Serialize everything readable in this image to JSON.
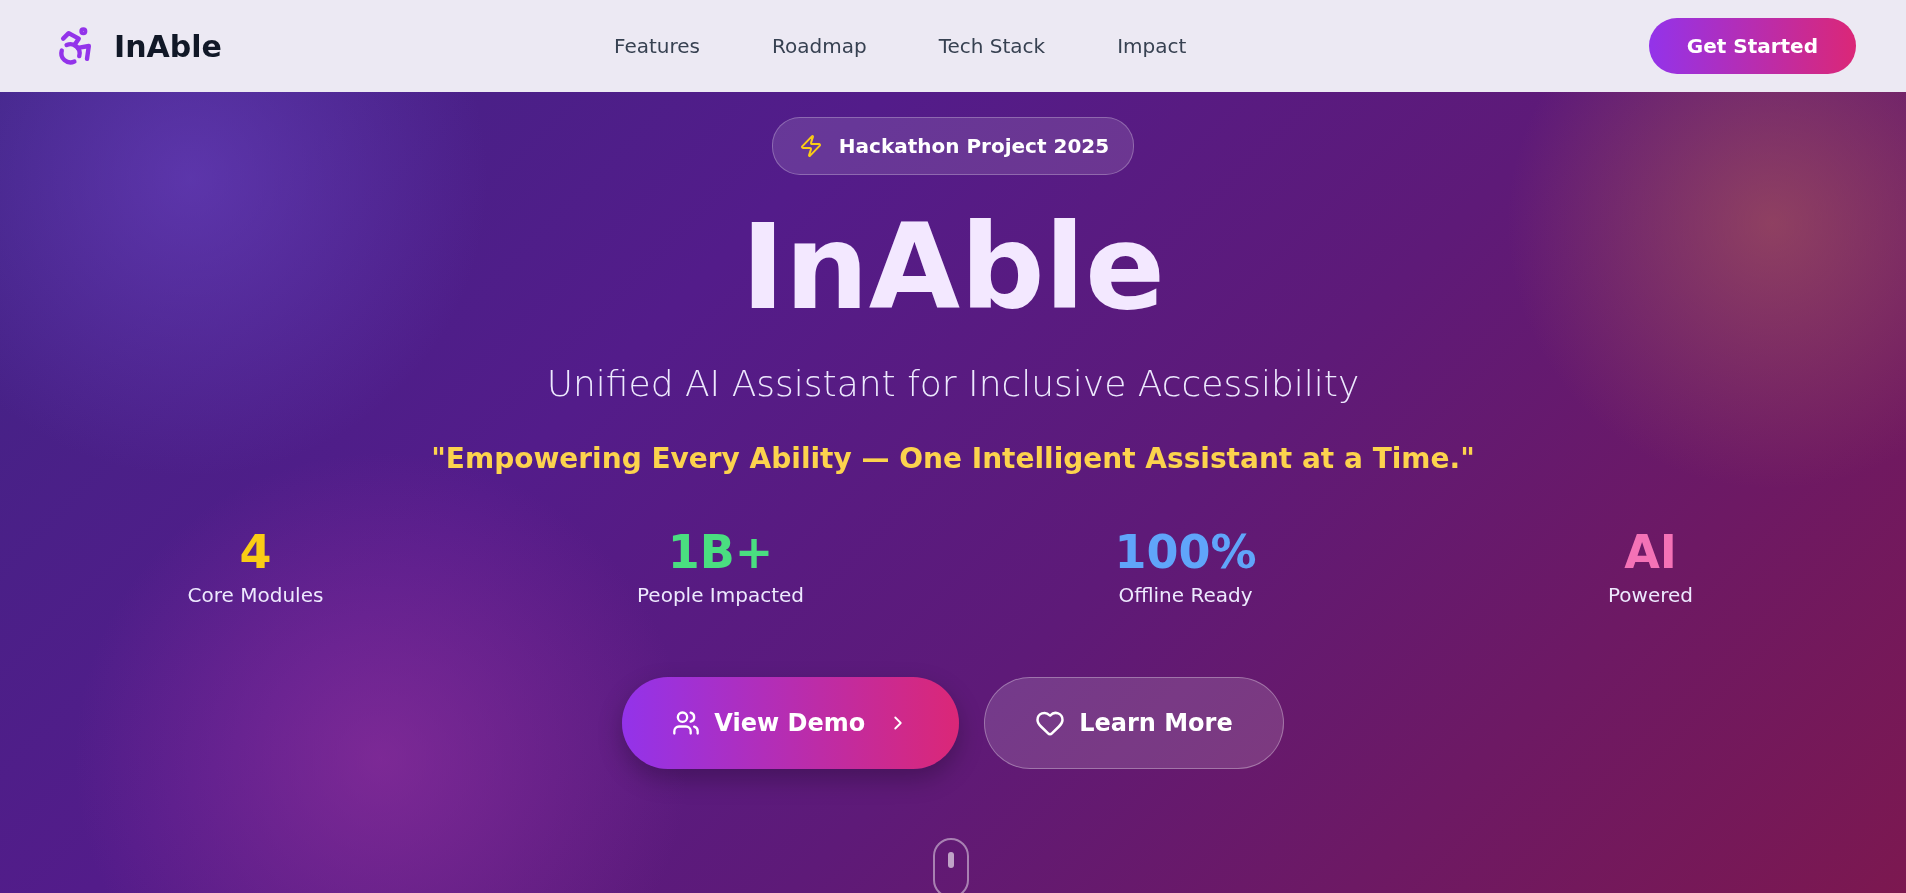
{
  "brand": {
    "name": "InAble"
  },
  "nav": {
    "links": [
      "Features",
      "Roadmap",
      "Tech Stack",
      "Impact"
    ],
    "cta": "Get Started"
  },
  "hero": {
    "badge": "Hackathon Project 2025",
    "title": "InAble",
    "subtitle": "Unified AI Assistant for Inclusive Accessibility",
    "tagline": "\"Empowering Every Ability — One Intelligent Assistant at a Time.\"",
    "stats": [
      {
        "value": "4",
        "label": "Core Modules",
        "color": "#facc15"
      },
      {
        "value": "1B+",
        "label": "People Impacted",
        "color": "#4ade80"
      },
      {
        "value": "100%",
        "label": "Offline Ready",
        "color": "#60a5fa"
      },
      {
        "value": "AI",
        "label": "Powered",
        "color": "#f472b6"
      }
    ],
    "buttons": [
      {
        "kind": "primary",
        "label": "View Demo"
      },
      {
        "kind": "secondary",
        "label": "Learn More"
      }
    ]
  }
}
